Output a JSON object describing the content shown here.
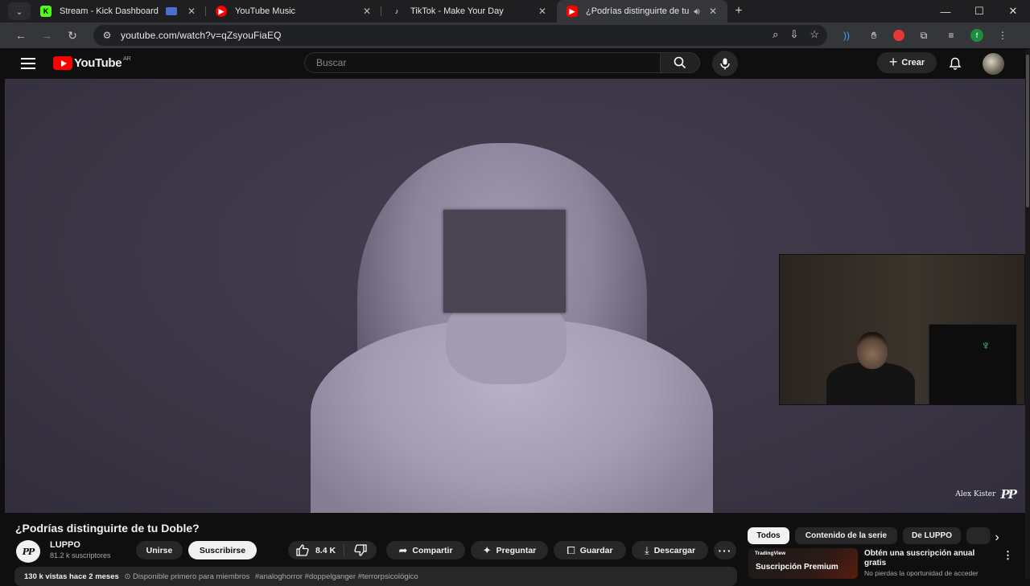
{
  "browser": {
    "tabs": [
      {
        "title": "Stream - Kick Dashboard",
        "icon": "kick-icon",
        "color": "#53fc18"
      },
      {
        "title": "YouTube Music",
        "icon": "youtube-music-icon",
        "color": "#ff0000"
      },
      {
        "title": "TikTok - Make Your Day",
        "icon": "tiktok-icon",
        "color": "#ffffff"
      },
      {
        "title": "¿Podrías distinguirte de tu Doble?",
        "icon": "youtube-icon",
        "color": "#ff0000",
        "active": true
      }
    ],
    "url": "youtube.com/watch?v=qZsyouFiaEQ"
  },
  "yt": {
    "logo_text": "YouTube",
    "country": "AR",
    "search_placeholder": "Buscar",
    "create_label": "Crear"
  },
  "video": {
    "watermark": "Alex Kister",
    "watermark_mark": "PP"
  },
  "meta": {
    "title": "¿Podrías distinguirte de tu Doble?",
    "channel_name": "LUPPO",
    "channel_avatar": "PP",
    "subscribers": "81.2 k suscriptores",
    "join_label": "Unirse",
    "subscribe_label": "Suscribirse",
    "likes": "8.4 K",
    "share_label": "Compartir",
    "ask_label": "Preguntar",
    "save_label": "Guardar",
    "download_label": "Descargar",
    "stats": "130 k vistas  hace 2 meses",
    "members_note": "⊙ Disponible primero para miembros",
    "tags": "#analoghorror #doppelganger #terrorpsicológico"
  },
  "sidebar": {
    "chips": [
      "Todos",
      "Contenido de la serie",
      "De LUPPO"
    ],
    "ad": {
      "brand": "TradingView",
      "thumb_title": "Suscripción Premium",
      "title": "Obtén una suscripción anual gratis",
      "subtitle": "No pierdas la oportunidad de acceder"
    }
  }
}
